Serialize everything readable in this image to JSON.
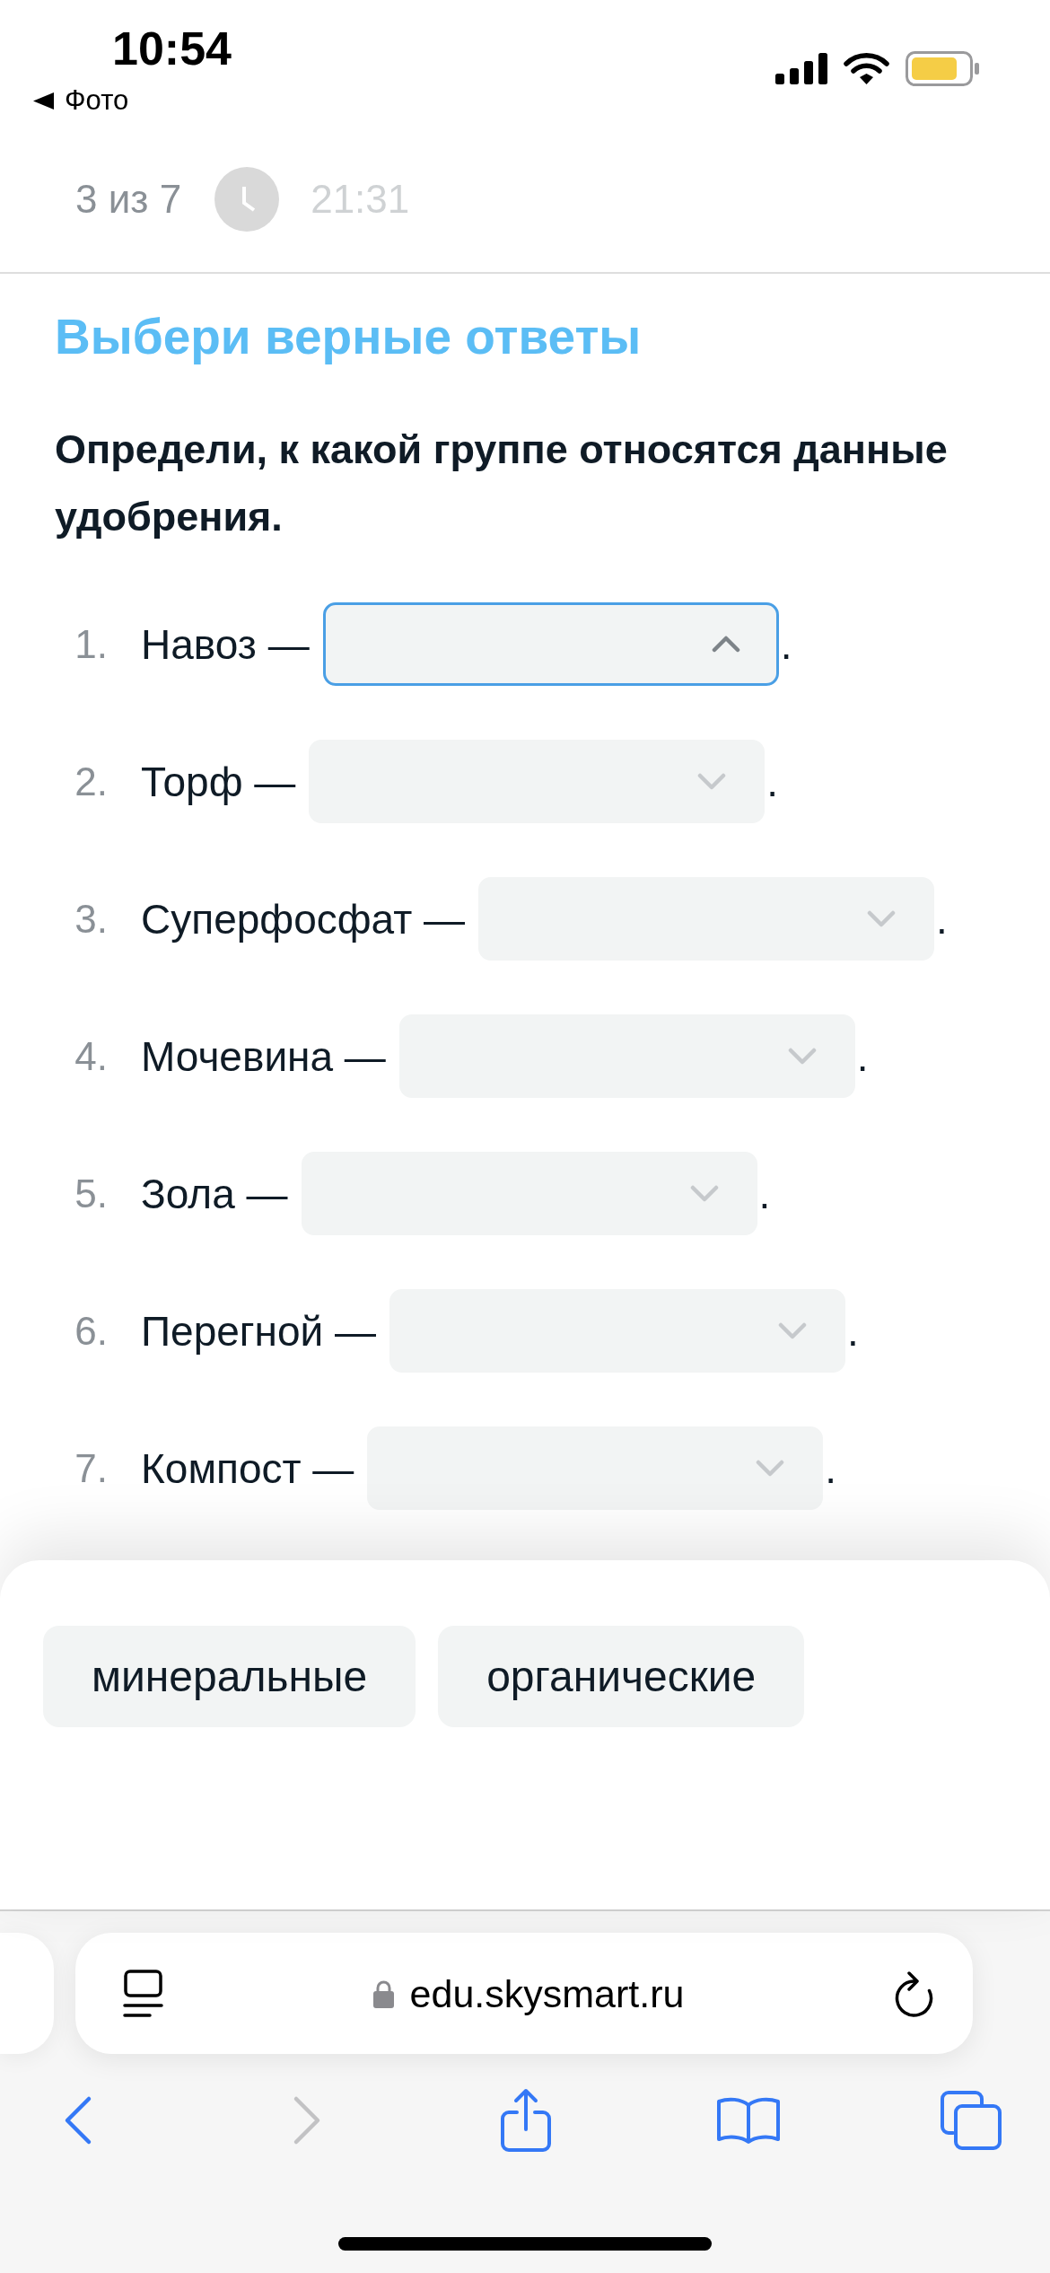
{
  "status_bar": {
    "time": "10:54",
    "back_app": "Фото"
  },
  "header": {
    "progress": "3 из 7",
    "timer": "21:31"
  },
  "task": {
    "title": "Выбери верные ответы",
    "question": "Определи, к какой группе относятся данные удобрения."
  },
  "items": [
    {
      "number": "1.",
      "label": "Навоз —",
      "expanded": true,
      "end": "."
    },
    {
      "number": "2.",
      "label": "Торф —",
      "expanded": false,
      "end": "."
    },
    {
      "number": "3.",
      "label": "Суперфосфат —",
      "expanded": false,
      "end": "."
    },
    {
      "number": "4.",
      "label": "Мочевина —",
      "expanded": false,
      "end": "."
    },
    {
      "number": "5.",
      "label": "Зола —",
      "expanded": false,
      "end": "."
    },
    {
      "number": "6.",
      "label": "Перегной —",
      "expanded": false,
      "end": "."
    },
    {
      "number": "7.",
      "label": "Компост —",
      "expanded": false,
      "end": "."
    }
  ],
  "options": [
    "минеральные",
    "органические"
  ],
  "browser": {
    "url": "edu.skysmart.ru",
    "back": {
      "disabled": false
    },
    "forward": {
      "disabled": true
    }
  }
}
